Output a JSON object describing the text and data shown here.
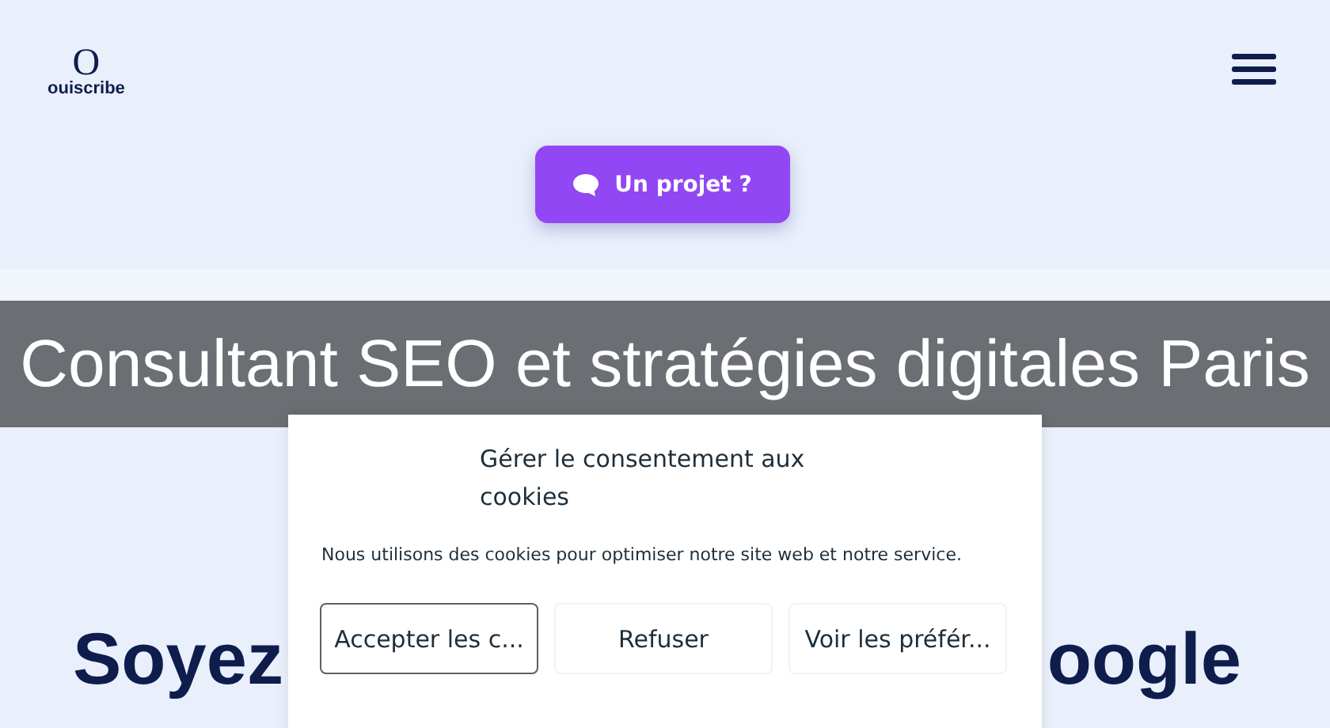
{
  "header": {
    "logo": {
      "mark": "O",
      "name": "ouiscribe"
    },
    "cta": "Un projet ?"
  },
  "banner": {
    "title": "Consultant SEO et stratégies digitales Paris"
  },
  "hero": {
    "heading_parts": [
      "Soyez",
      "oogle"
    ]
  },
  "cookie_dialog": {
    "title": "Gérer le consentement aux cookies",
    "text": "Nous utilisons des cookies pour optimiser notre site web et notre service.",
    "buttons": [
      {
        "label": "Accepter les c...",
        "kind": "primary"
      },
      {
        "label": "Refuser",
        "kind": "secondary"
      },
      {
        "label": "Voir les préfér...",
        "kind": "secondary"
      }
    ]
  }
}
